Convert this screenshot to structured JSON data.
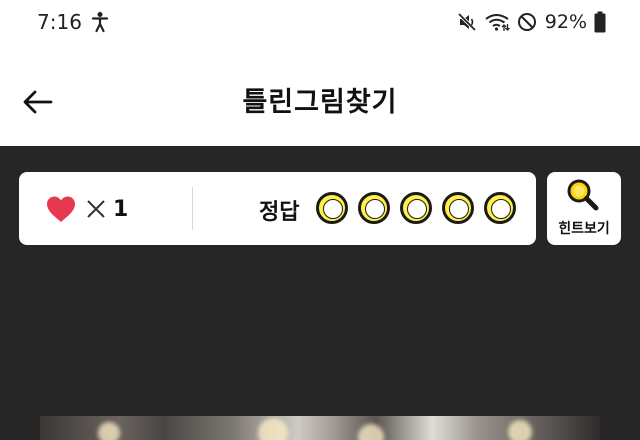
{
  "status_bar": {
    "time": "7:16",
    "battery_percent": "92%",
    "icons": [
      "accessibility-icon",
      "mute-icon",
      "wifi-icon",
      "do-not-disturb-icon",
      "battery-icon"
    ]
  },
  "header": {
    "title": "틀린그림찾기",
    "back_icon": "arrow-left-icon"
  },
  "score_panel": {
    "lives_icon": "heart-icon",
    "times_symbol_icon": "times-icon",
    "lives_count": "1",
    "answer_label": "정답",
    "answer_slots": 5,
    "answers_found": 0
  },
  "hint_button": {
    "icon": "magnifier-icon",
    "label": "힌트보기"
  },
  "colors": {
    "game_background": "#262626",
    "heart": "#e8384f",
    "slot_ring": "#fff04a",
    "hint_accent": "#ffd200"
  }
}
